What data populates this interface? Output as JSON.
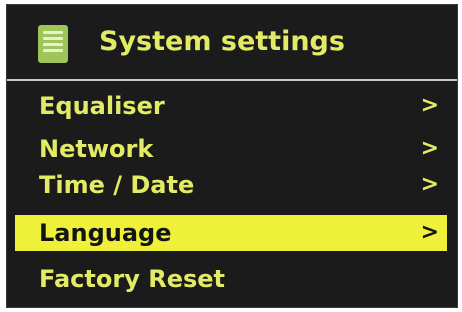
{
  "header": {
    "icon": "menu-list-icon",
    "title": "System settings"
  },
  "menu": {
    "items": [
      {
        "label": "Equaliser",
        "arrow": ">",
        "selected": false
      },
      {
        "label": "Network",
        "arrow": ">",
        "selected": false
      },
      {
        "label": "Time / Date",
        "arrow": ">",
        "selected": false
      },
      {
        "label": "Language",
        "arrow": ">",
        "selected": true
      },
      {
        "label": "Factory Reset",
        "arrow": "",
        "selected": false
      }
    ]
  },
  "colors": {
    "background": "#1b1b1b",
    "text": "#e3eb66",
    "highlight": "#eef03a",
    "highlight_text": "#141414",
    "icon": "#9fc45a"
  }
}
